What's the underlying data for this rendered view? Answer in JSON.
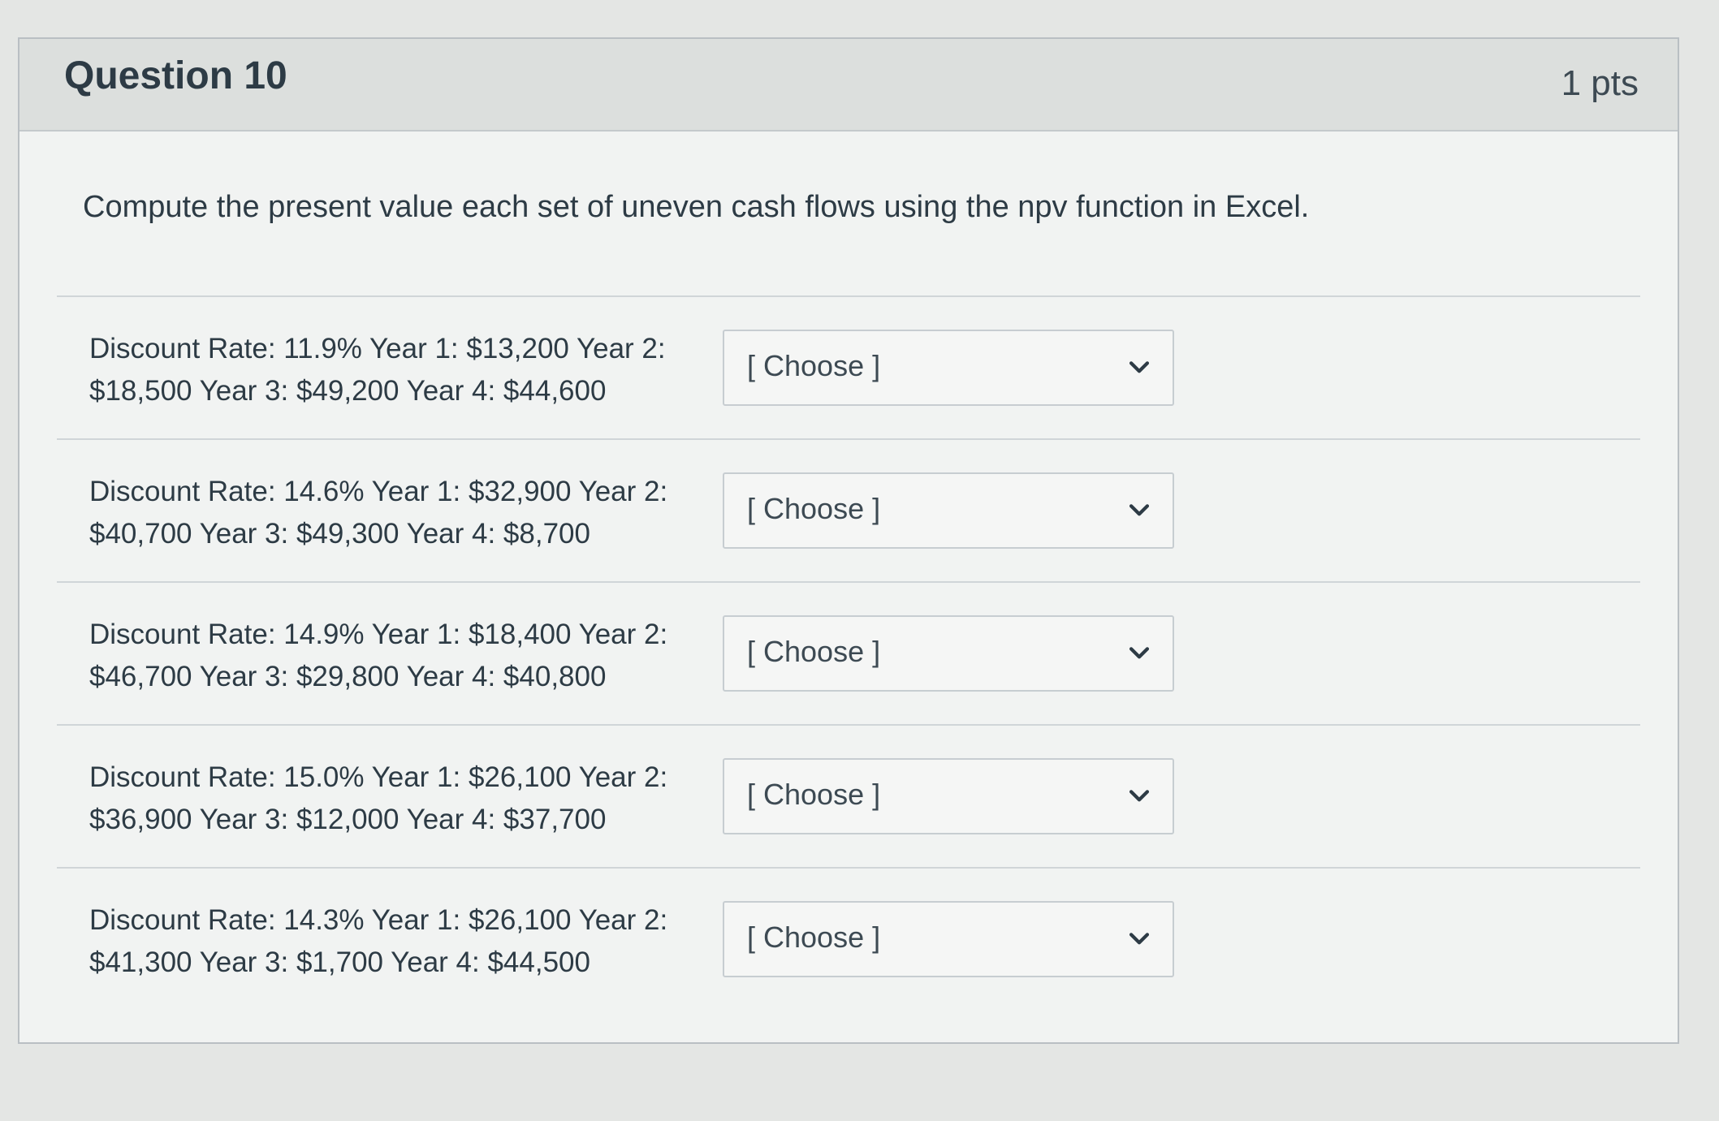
{
  "question": {
    "title": "Question 10",
    "points": "1 pts",
    "prompt": "Compute the present value each set of uneven cash flows using the npv function in Excel."
  },
  "answers": [
    {
      "label_line1": "Discount Rate: 11.9% Year 1: $13,200 Year 2:",
      "label_line2": "$18,500 Year 3: $49,200 Year 4: $44,600",
      "selected": "[ Choose ]"
    },
    {
      "label_line1": "Discount Rate: 14.6% Year 1: $32,900 Year 2:",
      "label_line2": "$40,700 Year 3: $49,300 Year 4: $8,700",
      "selected": "[ Choose ]"
    },
    {
      "label_line1": "Discount Rate: 14.9% Year 1: $18,400 Year 2:",
      "label_line2": "$46,700 Year 3: $29,800 Year 4: $40,800",
      "selected": "[ Choose ]"
    },
    {
      "label_line1": "Discount Rate: 15.0% Year 1: $26,100 Year 2:",
      "label_line2": "$36,900 Year 3: $12,000 Year 4: $37,700",
      "selected": "[ Choose ]"
    },
    {
      "label_line1": "Discount Rate: 14.3% Year 1: $26,100 Year 2:",
      "label_line2": "$41,300 Year 3: $1,700 Year 4: $44,500",
      "selected": "[ Choose ]"
    }
  ],
  "icons": {
    "dropdown": "chevron-down-icon"
  },
  "colors": {
    "text": "#2d3b45",
    "header_bg": "#dcdfdd",
    "card_bg": "#f1f3f2",
    "border": "#c7cdd1"
  }
}
